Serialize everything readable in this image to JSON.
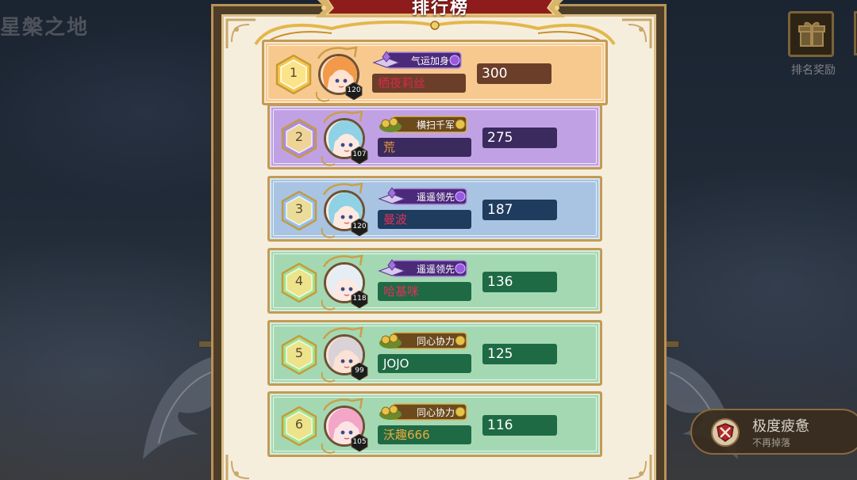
{
  "background": {
    "zone_title": "星槃之地"
  },
  "reward_button": {
    "label": "排名奖励",
    "icon": "gift-box-icon"
  },
  "fatigue_panel": {
    "title": "极度疲惫",
    "subtitle": "不再掉落",
    "icon": "cross-shield-icon"
  },
  "leaderboard": {
    "title": "排行榜",
    "rows": [
      {
        "rank": "1",
        "level": "120",
        "title_tag": "气运加身",
        "title_icon": "purple-crystal-book-icon",
        "name": "栖夜莉丝",
        "score": "300",
        "bg_color": "#f7c98f",
        "name_color": "#d62a4a",
        "name_box_color": "#6b3e2a",
        "score_box_color": "#6b3e2a",
        "avatar": "orange-hair-girl-avatar"
      },
      {
        "rank": "2",
        "level": "107",
        "title_tag": "横扫千军",
        "title_icon": "gold-coin-pile-icon",
        "name": "荒",
        "score": "275",
        "bg_color": "#c0a2e4",
        "name_color": "#f29a3a",
        "name_box_color": "#3a2a5e",
        "score_box_color": "#3a2a5e",
        "avatar": "blue-hair-girl-avatar"
      },
      {
        "rank": "3",
        "level": "120",
        "title_tag": "遥遥领先",
        "title_icon": "purple-crystal-book-icon",
        "name": "曼波",
        "score": "187",
        "bg_color": "#a8c4e2",
        "name_color": "#e0305a",
        "name_box_color": "#1f3b5e",
        "score_box_color": "#1f3b5e",
        "avatar": "blue-hair-girl-avatar"
      },
      {
        "rank": "4",
        "level": "118",
        "title_tag": "遥遥领先",
        "title_icon": "purple-crystal-book-icon",
        "name": "哈基咪",
        "score": "136",
        "bg_color": "#a4d8b3",
        "name_color": "#e0305a",
        "name_box_color": "#1e6a44",
        "score_box_color": "#1e6a44",
        "avatar": "white-hair-girl-avatar"
      },
      {
        "rank": "5",
        "level": "99",
        "title_tag": "同心协力",
        "title_icon": "gold-coin-pile-icon",
        "name": "JOJO",
        "score": "125",
        "bg_color": "#a4d8b3",
        "name_color": "#ffffff",
        "name_box_color": "#1e6a44",
        "score_box_color": "#1e6a44",
        "avatar": "silver-hair-girl-avatar"
      },
      {
        "rank": "6",
        "level": "105",
        "title_tag": "同心协力",
        "title_icon": "gold-coin-pile-icon",
        "name": "沃趣666",
        "score": "116",
        "bg_color": "#a4d8b3",
        "name_color": "#f2a93a",
        "name_box_color": "#1e6a44",
        "score_box_color": "#1e6a44",
        "avatar": "pink-hair-girl-avatar"
      }
    ]
  },
  "colors": {
    "panel_frame": "#b99257",
    "panel_bg": "#f6eedd",
    "banner_red": "#8e1c1c",
    "hex_fill": "#fbe38a",
    "hex_gold": "#f5c74a",
    "hex_purple": "#a98ae6",
    "hex_blue": "#8fc0f0",
    "hex_green": "#9ee58f"
  }
}
